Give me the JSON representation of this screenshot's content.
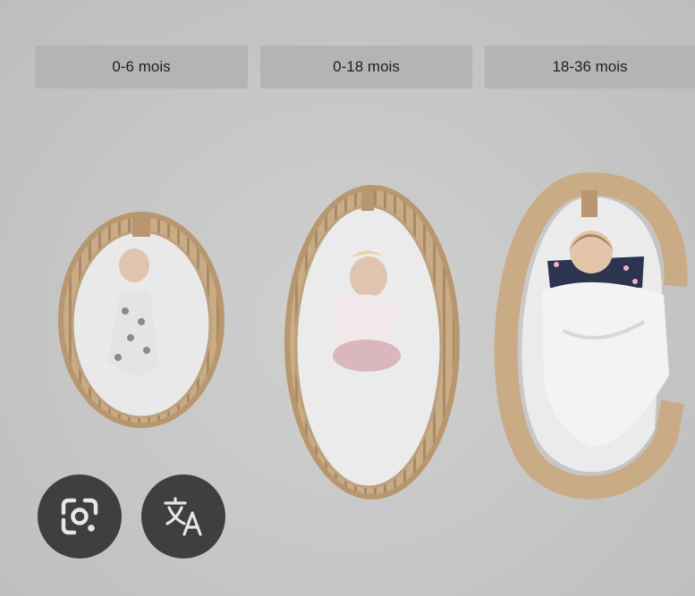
{
  "age_labels": [
    "0-6 mois",
    "0-18 mois",
    "18-36 mois"
  ],
  "buttons": {
    "lens": {
      "icon": "google-lens-icon"
    },
    "translate": {
      "icon": "translate-icon"
    }
  },
  "colors": {
    "background": "#c9c9c9",
    "label_bg": "#b4b4b4",
    "button_bg": "#3f3f3f",
    "icon": "#e6e6e6",
    "wood": "#c9ab85"
  }
}
